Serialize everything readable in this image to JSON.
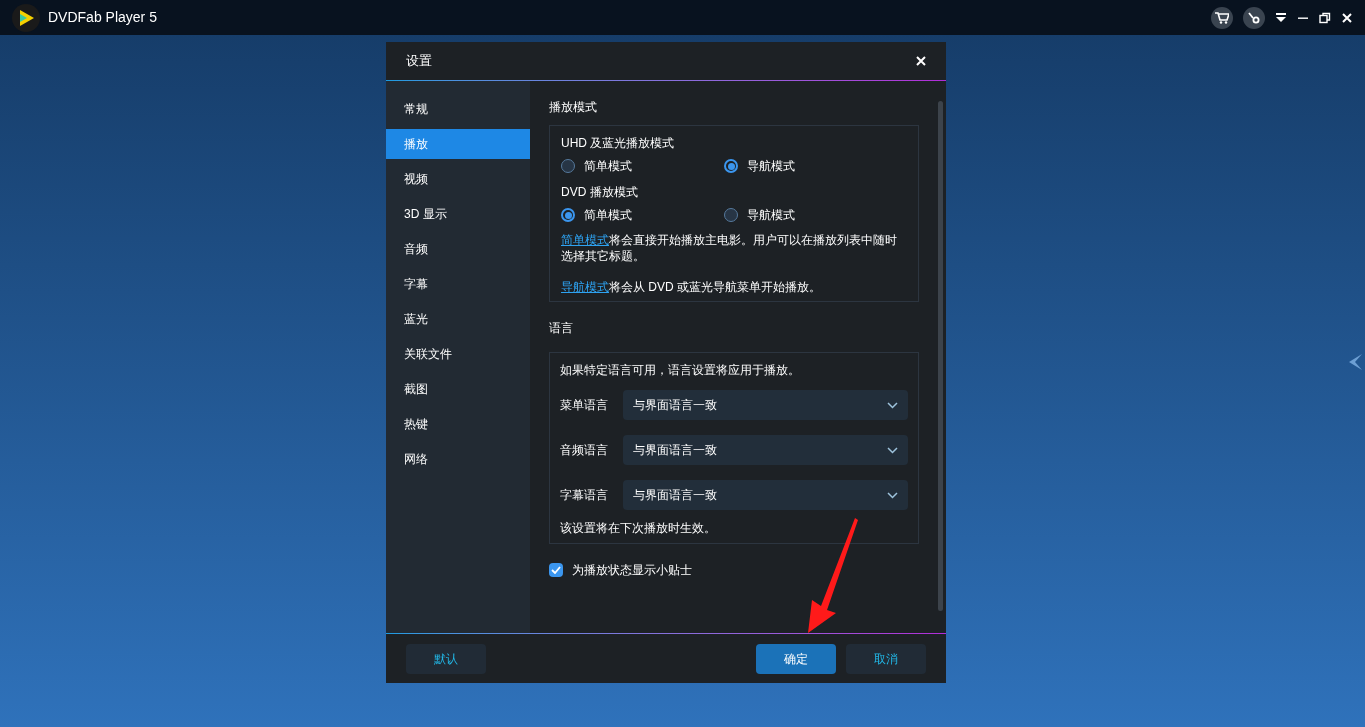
{
  "app": {
    "title": "DVDFab Player 5"
  },
  "dialog": {
    "title": "设置",
    "sidebar": {
      "items": [
        {
          "label": "常规",
          "selected": false
        },
        {
          "label": "播放",
          "selected": true
        },
        {
          "label": "视频",
          "selected": false
        },
        {
          "label": "3D 显示",
          "selected": false
        },
        {
          "label": "音频",
          "selected": false
        },
        {
          "label": "字幕",
          "selected": false
        },
        {
          "label": "蓝光",
          "selected": false
        },
        {
          "label": "关联文件",
          "selected": false
        },
        {
          "label": "截图",
          "selected": false
        },
        {
          "label": "热键",
          "selected": false
        },
        {
          "label": "网络",
          "selected": false
        }
      ]
    },
    "playback_section": {
      "heading": "播放模式",
      "groups": [
        {
          "label": "UHD 及蓝光播放模式",
          "options": [
            {
              "label": "简单模式",
              "selected": false
            },
            {
              "label": "导航模式",
              "selected": true
            }
          ]
        },
        {
          "label": "DVD 播放模式",
          "options": [
            {
              "label": "简单模式",
              "selected": true
            },
            {
              "label": "导航模式",
              "selected": false
            }
          ]
        }
      ],
      "notes": [
        {
          "link": "简单模式",
          "text": "将会直接开始播放主电影。用户可以在播放列表中随时选择其它标题。"
        },
        {
          "link": "导航模式",
          "text": "将会从 DVD 或蓝光导航菜单开始播放。"
        }
      ]
    },
    "language_section": {
      "heading": "语言",
      "intro": "如果特定语言可用，语言设置将应用于播放。",
      "dropdowns": [
        {
          "label": "菜单语言",
          "value": "与界面语言一致"
        },
        {
          "label": "音频语言",
          "value": "与界面语言一致"
        },
        {
          "label": "字幕语言",
          "value": "与界面语言一致"
        }
      ],
      "footnote": "该设置将在下次播放时生效。"
    },
    "tips_checkbox": {
      "label": "为播放状态显示小贴士",
      "checked": true
    },
    "buttons": {
      "default": "默认",
      "ok": "确定",
      "cancel": "取消"
    }
  }
}
